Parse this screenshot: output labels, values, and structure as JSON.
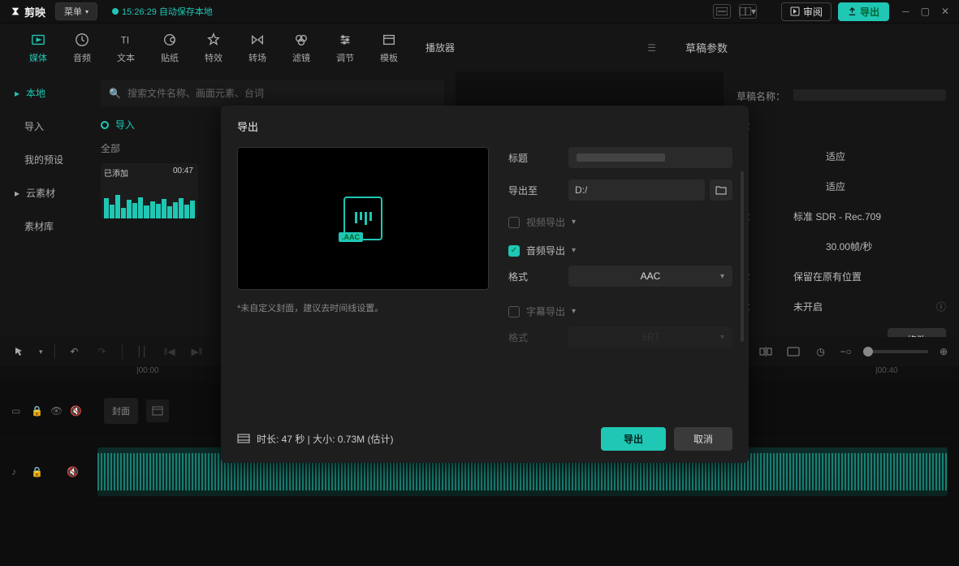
{
  "app": {
    "name": "剪映",
    "menu": "菜单"
  },
  "autosave": {
    "text": "15:26:29 自动保存本地"
  },
  "topbar": {
    "review": "审阅",
    "export": "导出"
  },
  "ribbon": [
    {
      "label": "媒体"
    },
    {
      "label": "音频"
    },
    {
      "label": "文本"
    },
    {
      "label": "贴纸"
    },
    {
      "label": "特效"
    },
    {
      "label": "转场"
    },
    {
      "label": "滤镜"
    },
    {
      "label": "调节"
    },
    {
      "label": "模板"
    }
  ],
  "ribbon_center": {
    "player": "播放器",
    "params": "草稿参数"
  },
  "sidebar": {
    "local": "本地",
    "import": "导入",
    "preset": "我的预设",
    "cloud": "云素材",
    "library": "素材库"
  },
  "search": {
    "placeholder": "搜索文件名称、画面元素、台词"
  },
  "import_label": "导入",
  "filter_all": "全部",
  "thumb": {
    "badge": "已添加",
    "time": "00:47"
  },
  "params": {
    "name_label": "草稿名称：",
    "fit1": "适应",
    "fit2": "适应",
    "color": "标准 SDR - Rec.709",
    "fps": "30.00帧/秒",
    "keep": "保留在原有位置",
    "off": "未开启",
    "modify": "修改"
  },
  "ruler": {
    "t0": "|00:00",
    "t40": "|00:40"
  },
  "track": {
    "cover": "封面"
  },
  "dialog": {
    "title": "导出",
    "preview_note": "*未自定义封面，建议去时间线设置。",
    "aac_badge": ".AAC",
    "form": {
      "title_label": "标题",
      "path_label": "导出至",
      "path_value": "D:/",
      "video_section": "视频导出",
      "audio_section": "音频导出",
      "format_label": "格式",
      "format_value": "AAC",
      "subtitle_section": "字幕导出",
      "subtitle_label": "格式",
      "subtitle_value": "SRT"
    },
    "footer": {
      "info": "时长:  47 秒 | 大小:  0.73M  (估计)",
      "export": "导出",
      "cancel": "取消"
    }
  }
}
